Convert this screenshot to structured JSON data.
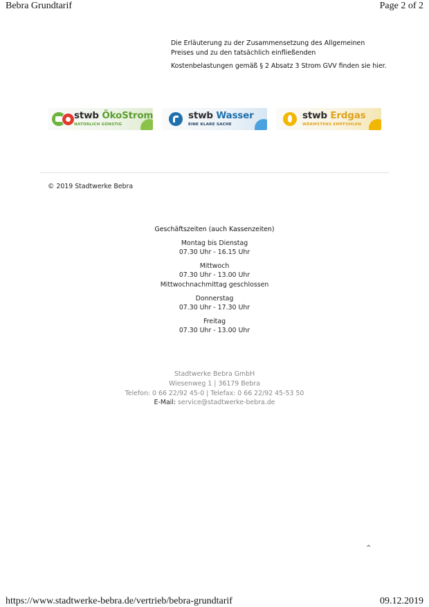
{
  "print_header": {
    "title": "Bebra Grundtarif",
    "page": "Page 2 of 2"
  },
  "intro": {
    "line1": "Die Erläuterung zu der Zusammensetzung des Allgemeinen",
    "line2": "Preises und zu den tatsächlich einfließenden",
    "line3": "Kostenbelastungen gemäß § 2 Absatz 3 Strom GVV finden sie hier."
  },
  "logos": [
    {
      "prefix": "stwb",
      "brand": "ÖkoStrom",
      "tagline": "NATÜRLICH GÜNSTIG",
      "color": "#5a9e2e"
    },
    {
      "prefix": "stwb",
      "brand": "Wasser",
      "tagline": "EINE KLARE SACHE",
      "color": "#1f6fad"
    },
    {
      "prefix": "stwb",
      "brand": "Erdgas",
      "tagline": "WÄRMSTENS EMPFOHLEN",
      "color": "#e0a31c"
    }
  ],
  "footer_site": {
    "copyright": "© 2019 Stadtwerke Bebra"
  },
  "hours": {
    "title": "Geschäftszeiten (auch Kassenzeiten)",
    "groups": [
      {
        "day": "Montag bis Dienstag",
        "time": "07.30 Uhr - 16.15 Uhr"
      },
      {
        "day": "Mittwoch",
        "time": "07.30 Uhr - 13.00 Uhr",
        "note": "Mittwochnachmittag geschlossen"
      },
      {
        "day": "Donnerstag",
        "time": "07.30 Uhr - 17.30 Uhr"
      },
      {
        "day": "Freitag",
        "time": "07.30 Uhr - 13.00 Uhr"
      }
    ]
  },
  "contact": {
    "company": "Stadtwerke Bebra GmbH",
    "address": "Wiesenweg 1 | 36179 Bebra",
    "phone": "Telefon: 0 66 22/92 45-0 | Telefax: 0 66 22/92 45-53 50",
    "email_label": "E-Mail:",
    "email": "service@stadtwerke-bebra.de"
  },
  "scroll_top_glyph": "^",
  "print_footer": {
    "url": "https://www.stadtwerke-bebra.de/vertrieb/bebra-grundtarif",
    "date": "09.12.2019"
  }
}
